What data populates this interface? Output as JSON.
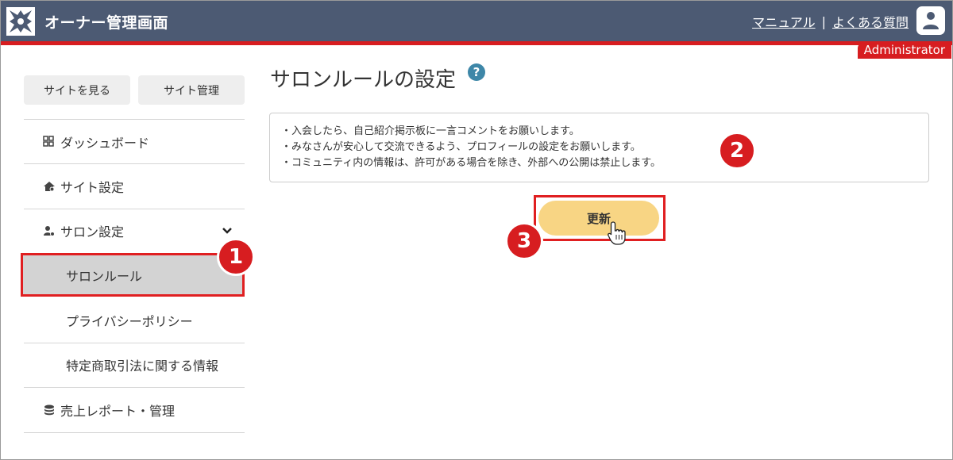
{
  "header": {
    "title": "オーナー管理画面",
    "links": [
      "マニュアル",
      "よくある質問"
    ],
    "separator": "|",
    "role_badge": "Administrator",
    "colors": {
      "bar": "#4c5a73",
      "accent": "#d71d20"
    }
  },
  "sidebar": {
    "top_buttons": [
      "サイトを見る",
      "サイト管理"
    ],
    "items": [
      {
        "label": "ダッシュボード",
        "icon": "grid-icon"
      },
      {
        "label": "サイト設定",
        "icon": "house-gear-icon"
      },
      {
        "label": "サロン設定",
        "icon": "user-gear-icon",
        "expanded": true
      },
      {
        "label": "サロンルール",
        "active": true
      },
      {
        "label": "プライバシーポリシー"
      },
      {
        "label": "特定商取引法に関する情報"
      },
      {
        "label": "売上レポート・管理",
        "icon": "coins-icon"
      }
    ]
  },
  "main": {
    "title": "サロンルールの設定",
    "rules": [
      "・入会したら、自己紹介掲示板に一言コメントをお願いします。",
      "・みなさんが安心して交流できるよう、プロフィールの設定をお願いします。",
      "・コミュニティ内の情報は、許可がある場合を除き、外部への公開は禁止します。"
    ],
    "update_label": "更新",
    "button_color": "#f8d584"
  },
  "steps": [
    "1",
    "2",
    "3"
  ]
}
